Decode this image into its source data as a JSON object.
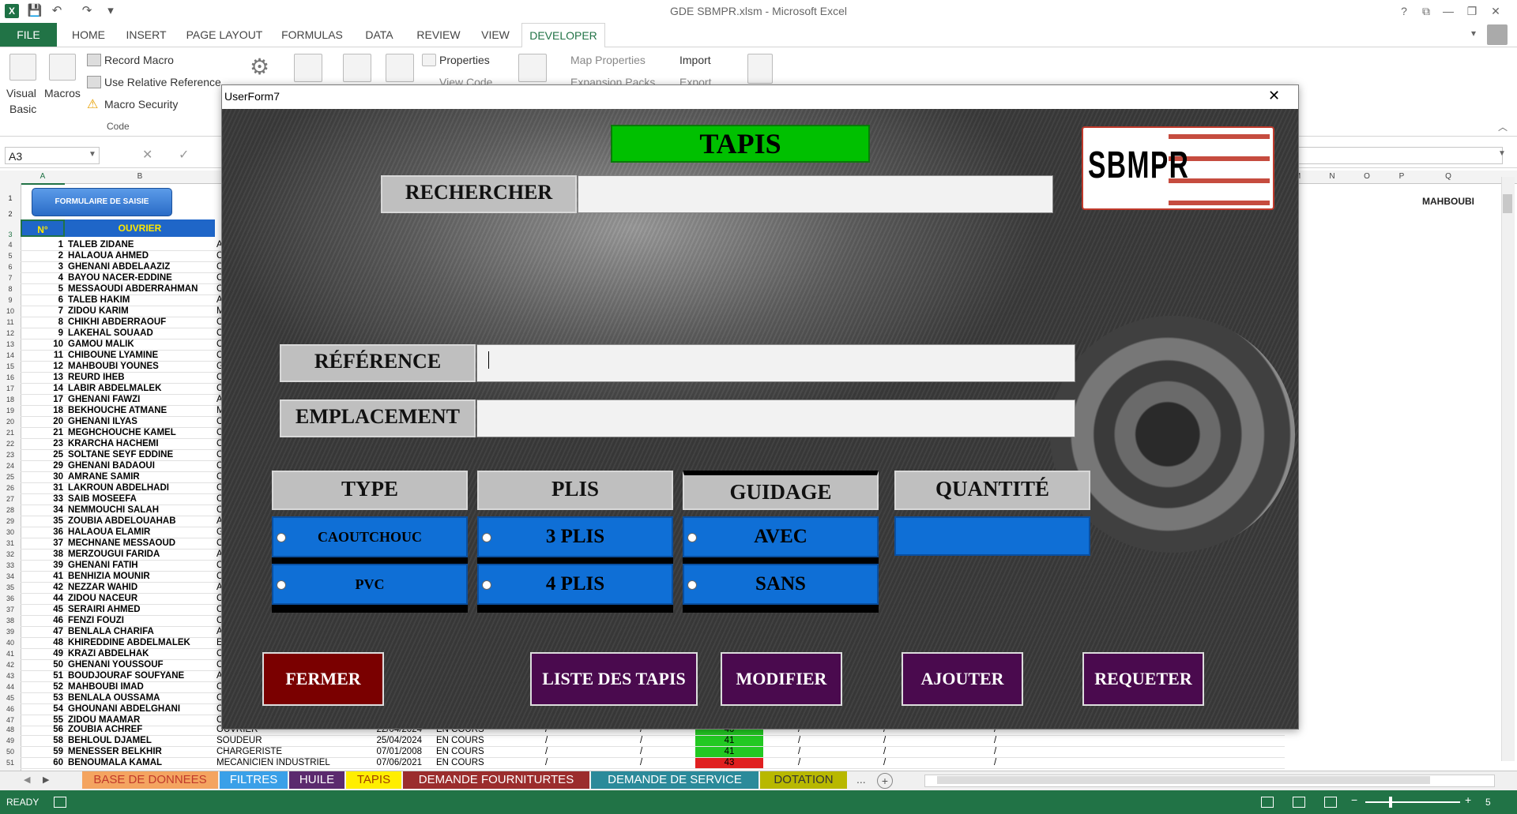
{
  "window": {
    "title": "GDE SBMPR.xlsm - Microsoft Excel",
    "help": "?"
  },
  "ribbon_tabs": [
    "FILE",
    "HOME",
    "INSERT",
    "PAGE LAYOUT",
    "FORMULAS",
    "DATA",
    "REVIEW",
    "VIEW",
    "DEVELOPER"
  ],
  "ribbon": {
    "visual_basic": "Visual",
    "visual_basic2": "Basic",
    "macros": "Macros",
    "record_macro": "Record Macro",
    "use_relative": "Use Relative Reference",
    "macro_security": "Macro Security",
    "code_group": "Code",
    "properties": "Properties",
    "view_code": "View Code",
    "map_properties": "Map Properties",
    "expansion_packs": "Expansion Packs",
    "import": "Import",
    "export": "Export"
  },
  "formula_bar": {
    "name_box": "A3"
  },
  "sheet": {
    "cols_left": [
      "A",
      "B"
    ],
    "cols_right": [
      "M",
      "N",
      "O",
      "P",
      "Q"
    ],
    "form_button": "FORMULAIRE DE SAISIE",
    "header_num": "N°",
    "header_name": "OUVRIER",
    "q1": "MAHBOUBI",
    "rows": [
      {
        "n": "1",
        "name": "TALEB ZIDANE",
        "c": "A"
      },
      {
        "n": "2",
        "name": "HALAOUA AHMED",
        "c": "C"
      },
      {
        "n": "3",
        "name": "GHENANI ABDELAAZIZ",
        "c": "C"
      },
      {
        "n": "4",
        "name": "BAYOU NACER-EDDINE",
        "c": "C"
      },
      {
        "n": "5",
        "name": "MESSAOUDI ABDERRAHMAN",
        "c": "C"
      },
      {
        "n": "6",
        "name": "TALEB HAKIM",
        "c": "A"
      },
      {
        "n": "7",
        "name": "ZIDOU KARIM",
        "c": "M"
      },
      {
        "n": "8",
        "name": "CHIKHI ABDERRAOUF",
        "c": "C"
      },
      {
        "n": "9",
        "name": "LAKEHAL SOUAAD",
        "c": "C"
      },
      {
        "n": "10",
        "name": "GAMOU MALIK",
        "c": "C"
      },
      {
        "n": "11",
        "name": "CHIBOUNE LYAMINE",
        "c": "C"
      },
      {
        "n": "12",
        "name": "MAHBOUBI YOUNES",
        "c": "G"
      },
      {
        "n": "13",
        "name": "REURD IHEB",
        "c": "C"
      },
      {
        "n": "14",
        "name": "LABIR ABDELMALEK",
        "c": "C"
      },
      {
        "n": "17",
        "name": "GHENANI FAWZI",
        "c": "A"
      },
      {
        "n": "18",
        "name": "BEKHOUCHE ATMANE",
        "c": "M"
      },
      {
        "n": "20",
        "name": "GHENANI ILYAS",
        "c": "C"
      },
      {
        "n": "21",
        "name": "MEGHCHOUCHE KAMEL",
        "c": "C"
      },
      {
        "n": "23",
        "name": "KRARCHA HACHEMI",
        "c": "C"
      },
      {
        "n": "25",
        "name": "SOLTANE SEYF EDDINE",
        "c": "C"
      },
      {
        "n": "29",
        "name": "GHENANI BADAOUI",
        "c": "C"
      },
      {
        "n": "30",
        "name": "AMRANE SAMIR",
        "c": "C"
      },
      {
        "n": "31",
        "name": "LAKROUN ABDELHADI",
        "c": "C"
      },
      {
        "n": "33",
        "name": "SAIB MOSEEFA",
        "c": "C"
      },
      {
        "n": "34",
        "name": "NEMMOUCHI SALAH",
        "c": "C"
      },
      {
        "n": "35",
        "name": "ZOUBIA ABDELOUAHAB",
        "c": "A"
      },
      {
        "n": "36",
        "name": "HALAOUA ELAMIR",
        "c": "G"
      },
      {
        "n": "37",
        "name": "MECHNANE MESSAOUD",
        "c": "C"
      },
      {
        "n": "38",
        "name": "MERZOUGUI FARIDA",
        "c": "A"
      },
      {
        "n": "39",
        "name": "GHENANI FATIH",
        "c": "C"
      },
      {
        "n": "41",
        "name": "BENHIZIA MOUNIR",
        "c": "C"
      },
      {
        "n": "42",
        "name": "NEZZAR WAHID",
        "c": "A"
      },
      {
        "n": "44",
        "name": "ZIDOU NACEUR",
        "c": "C"
      },
      {
        "n": "45",
        "name": "SERAIRI AHMED",
        "c": "C"
      },
      {
        "n": "46",
        "name": "FENZI FOUZI",
        "c": "C"
      },
      {
        "n": "47",
        "name": "BENLALA CHARIFA",
        "c": "A"
      },
      {
        "n": "48",
        "name": "KHIREDDINE ABDELMALEK",
        "c": "E"
      },
      {
        "n": "49",
        "name": "KRAZI ABDELHAK",
        "c": "C"
      },
      {
        "n": "50",
        "name": "GHENANI YOUSSOUF",
        "c": "C"
      },
      {
        "n": "51",
        "name": "BOUDJOURAF SOUFYANE",
        "c": "A"
      },
      {
        "n": "52",
        "name": "MAHBOUBI IMAD",
        "c": "C"
      },
      {
        "n": "53",
        "name": "BENLALA OUSSAMA",
        "c": "C"
      },
      {
        "n": "54",
        "name": "GHOUNANI ABDELGHANI",
        "c": "C"
      },
      {
        "n": "55",
        "name": "ZIDOU MAAMAR",
        "c": "C"
      }
    ],
    "bottom_rows": [
      {
        "n": "56",
        "name": "ZOUBIA ACHREF",
        "job": "OUVRIER",
        "date": "22/04/2024",
        "status": "EN COURS",
        "val": "40",
        "color": "#22c922"
      },
      {
        "n": "58",
        "name": "BEHLOUL DJAMEL",
        "job": "SOUDEUR",
        "date": "25/04/2024",
        "status": "EN COURS",
        "val": "41",
        "color": "#22c922"
      },
      {
        "n": "59",
        "name": "MENESSER BELKHIR",
        "job": "CHARGERISTE",
        "date": "07/01/2008",
        "status": "EN COURS",
        "val": "41",
        "color": "#22c922"
      },
      {
        "n": "60",
        "name": "BENOUMALA KAMAL",
        "job": "MECANICIEN INDUSTRIEL",
        "date": "07/06/2021",
        "status": "EN COURS",
        "val": "43",
        "color": "#e02020"
      }
    ],
    "mark": "/"
  },
  "sheet_tabs": [
    {
      "label": "BASE DE DONNEES",
      "bg": "#f4a460",
      "fg": "#c0392b"
    },
    {
      "label": "FILTRES",
      "bg": "#3aa0e8",
      "fg": "#ffffff"
    },
    {
      "label": "HUILE",
      "bg": "#5b2a6e",
      "fg": "#ffffff"
    },
    {
      "label": "TAPIS",
      "bg": "#ffee00",
      "fg": "#a04000"
    },
    {
      "label": "DEMANDE FOURNITURTES",
      "bg": "#9b2d2d",
      "fg": "#ffffff"
    },
    {
      "label": "DEMANDE DE SERVICE",
      "bg": "#2b8a9a",
      "fg": "#ffffff"
    },
    {
      "label": "DOTATION",
      "bg": "#b8b800",
      "fg": "#333333"
    }
  ],
  "sheet_tabs_more": "...",
  "status": {
    "ready": "READY",
    "zoom": "5"
  },
  "userform": {
    "title": "UserForm7",
    "close": "✕",
    "heading": "TAPIS",
    "logo": "SBMPR",
    "search_label": "RECHERCHER",
    "reference_label": "RÉFÉRENCE",
    "emplacement_label": "EMPLACEMENT",
    "type_label": "TYPE",
    "plis_label": "PLIS",
    "guidage_label": "GUIDAGE",
    "quantite_label": "QUANTITÉ",
    "type_opts": [
      "CAOUTCHOUC",
      "PVC"
    ],
    "plis_opts": [
      "3 PLIS",
      "4 PLIS"
    ],
    "guidage_opts": [
      "AVEC",
      "SANS"
    ],
    "buttons": {
      "fermer": "FERMER",
      "liste": "LISTE DES TAPIS",
      "modifier": "MODIFIER",
      "ajouter": "AJOUTER",
      "requeter": "REQUETER"
    },
    "colors": {
      "heading_bg": "#00c000",
      "fermer_bg": "#7a0000",
      "purple_bg": "#4a0a4e",
      "option_bg": "#0f6fd6"
    }
  }
}
